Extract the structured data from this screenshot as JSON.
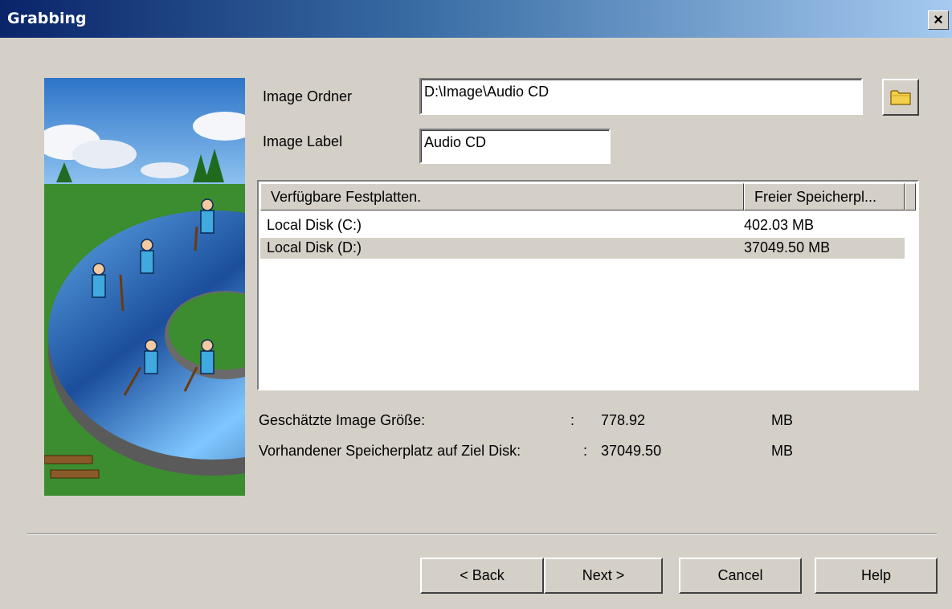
{
  "window": {
    "title": "Grabbing",
    "close_label": "×"
  },
  "form": {
    "folder_label": "Image Ordner",
    "folder_value": "D:\\Image\\Audio CD",
    "label_label": "Image Label",
    "label_value": "Audio CD"
  },
  "disks": {
    "columns": [
      "Verfügbare Festplatten.",
      "Freier Speicherpl..."
    ],
    "rows": [
      {
        "name": "Local Disk (C:)",
        "free": "402.03 MB",
        "selected": false
      },
      {
        "name": "Local Disk (D:)",
        "free": "37049.50 MB",
        "selected": true
      }
    ]
  },
  "summary": {
    "estimated_label": "Geschätzte Image Größe:",
    "estimated_colon": ":",
    "estimated_value": "778.92",
    "estimated_unit": "MB",
    "available_label": "Vorhandener Speicherplatz auf Ziel Disk:",
    "available_colon": ":",
    "available_value": "37049.50",
    "available_unit": "MB"
  },
  "buttons": {
    "back": "< Back",
    "next": "Next >",
    "cancel": "Cancel",
    "help": "Help"
  },
  "icons": {
    "browse": "folder-icon",
    "illustration": "disc-cleaning-workers-illustration"
  },
  "colors": {
    "titlebar_start": "#0a246a",
    "titlebar_end": "#a6caf0",
    "dialog_bg": "#d4d0c8",
    "selected_row": "#d4d0c8"
  }
}
